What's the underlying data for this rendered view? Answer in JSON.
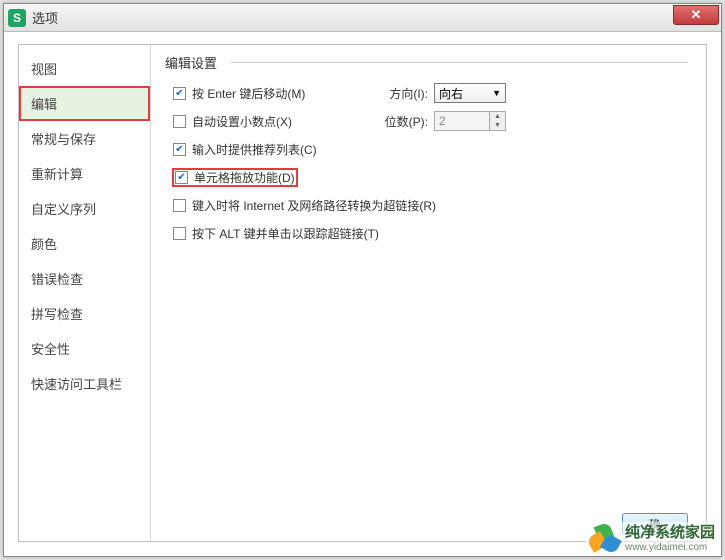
{
  "window": {
    "title": "选项",
    "app_icon_letter": "S"
  },
  "sidebar": {
    "items": [
      {
        "label": "视图"
      },
      {
        "label": "编辑"
      },
      {
        "label": "常规与保存"
      },
      {
        "label": "重新计算"
      },
      {
        "label": "自定义序列"
      },
      {
        "label": "颜色"
      },
      {
        "label": "错误检查"
      },
      {
        "label": "拼写检查"
      },
      {
        "label": "安全性"
      },
      {
        "label": "快速访问工具栏"
      }
    ],
    "active_index": 1
  },
  "main": {
    "section_title": "编辑设置",
    "options": {
      "enter_move": {
        "checked": true,
        "label": "按 Enter 键后移动(M)"
      },
      "direction": {
        "label": "方向(I):",
        "value": "向右"
      },
      "auto_decimal": {
        "checked": false,
        "label": "自动设置小数点(X)"
      },
      "places": {
        "label": "位数(P):",
        "value": "2"
      },
      "suggest_list": {
        "checked": true,
        "label": "输入时提供推荐列表(C)"
      },
      "drag_drop": {
        "checked": true,
        "label": "单元格拖放功能(D)"
      },
      "internet_link": {
        "checked": false,
        "label": "键入时将 Internet 及网络路径转换为超链接(R)"
      },
      "alt_click": {
        "checked": false,
        "label": "按下 ALT 键并单击以跟踪超链接(T)"
      }
    }
  },
  "footer": {
    "ok_label": "确"
  },
  "watermark": {
    "title": "纯净系统家园",
    "url": "www.yidaimei.com"
  }
}
